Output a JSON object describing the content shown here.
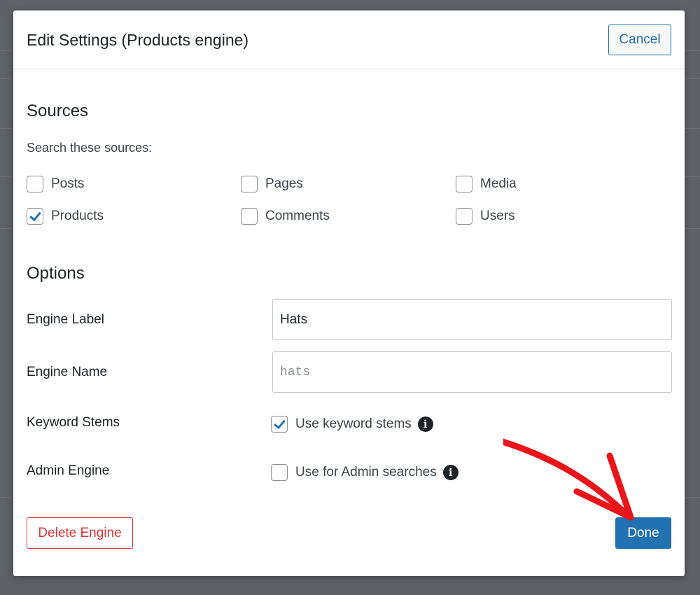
{
  "modal": {
    "title": "Edit Settings (Products engine)",
    "cancel_label": "Cancel"
  },
  "sources": {
    "heading": "Sources",
    "subheading": "Search these sources:",
    "items": [
      {
        "label": "Posts",
        "checked": false
      },
      {
        "label": "Pages",
        "checked": false
      },
      {
        "label": "Media",
        "checked": false
      },
      {
        "label": "Products",
        "checked": true
      },
      {
        "label": "Comments",
        "checked": false
      },
      {
        "label": "Users",
        "checked": false
      }
    ]
  },
  "options": {
    "heading": "Options",
    "engine_label": {
      "label": "Engine Label",
      "value": "Hats"
    },
    "engine_name": {
      "label": "Engine Name",
      "value": "hats"
    },
    "keyword_stems": {
      "label": "Keyword Stems",
      "checkbox_label": "Use keyword stems",
      "checked": true
    },
    "admin_engine": {
      "label": "Admin Engine",
      "checkbox_label": "Use for Admin searches",
      "checked": false
    }
  },
  "footer": {
    "delete_label": "Delete Engine",
    "done_label": "Done"
  },
  "colors": {
    "accent": "#2271b1",
    "danger": "#d63638",
    "annotation_arrow": "#e8151b"
  },
  "icons": {
    "info": "info-icon",
    "annotation": "red-arrow-annotation"
  }
}
